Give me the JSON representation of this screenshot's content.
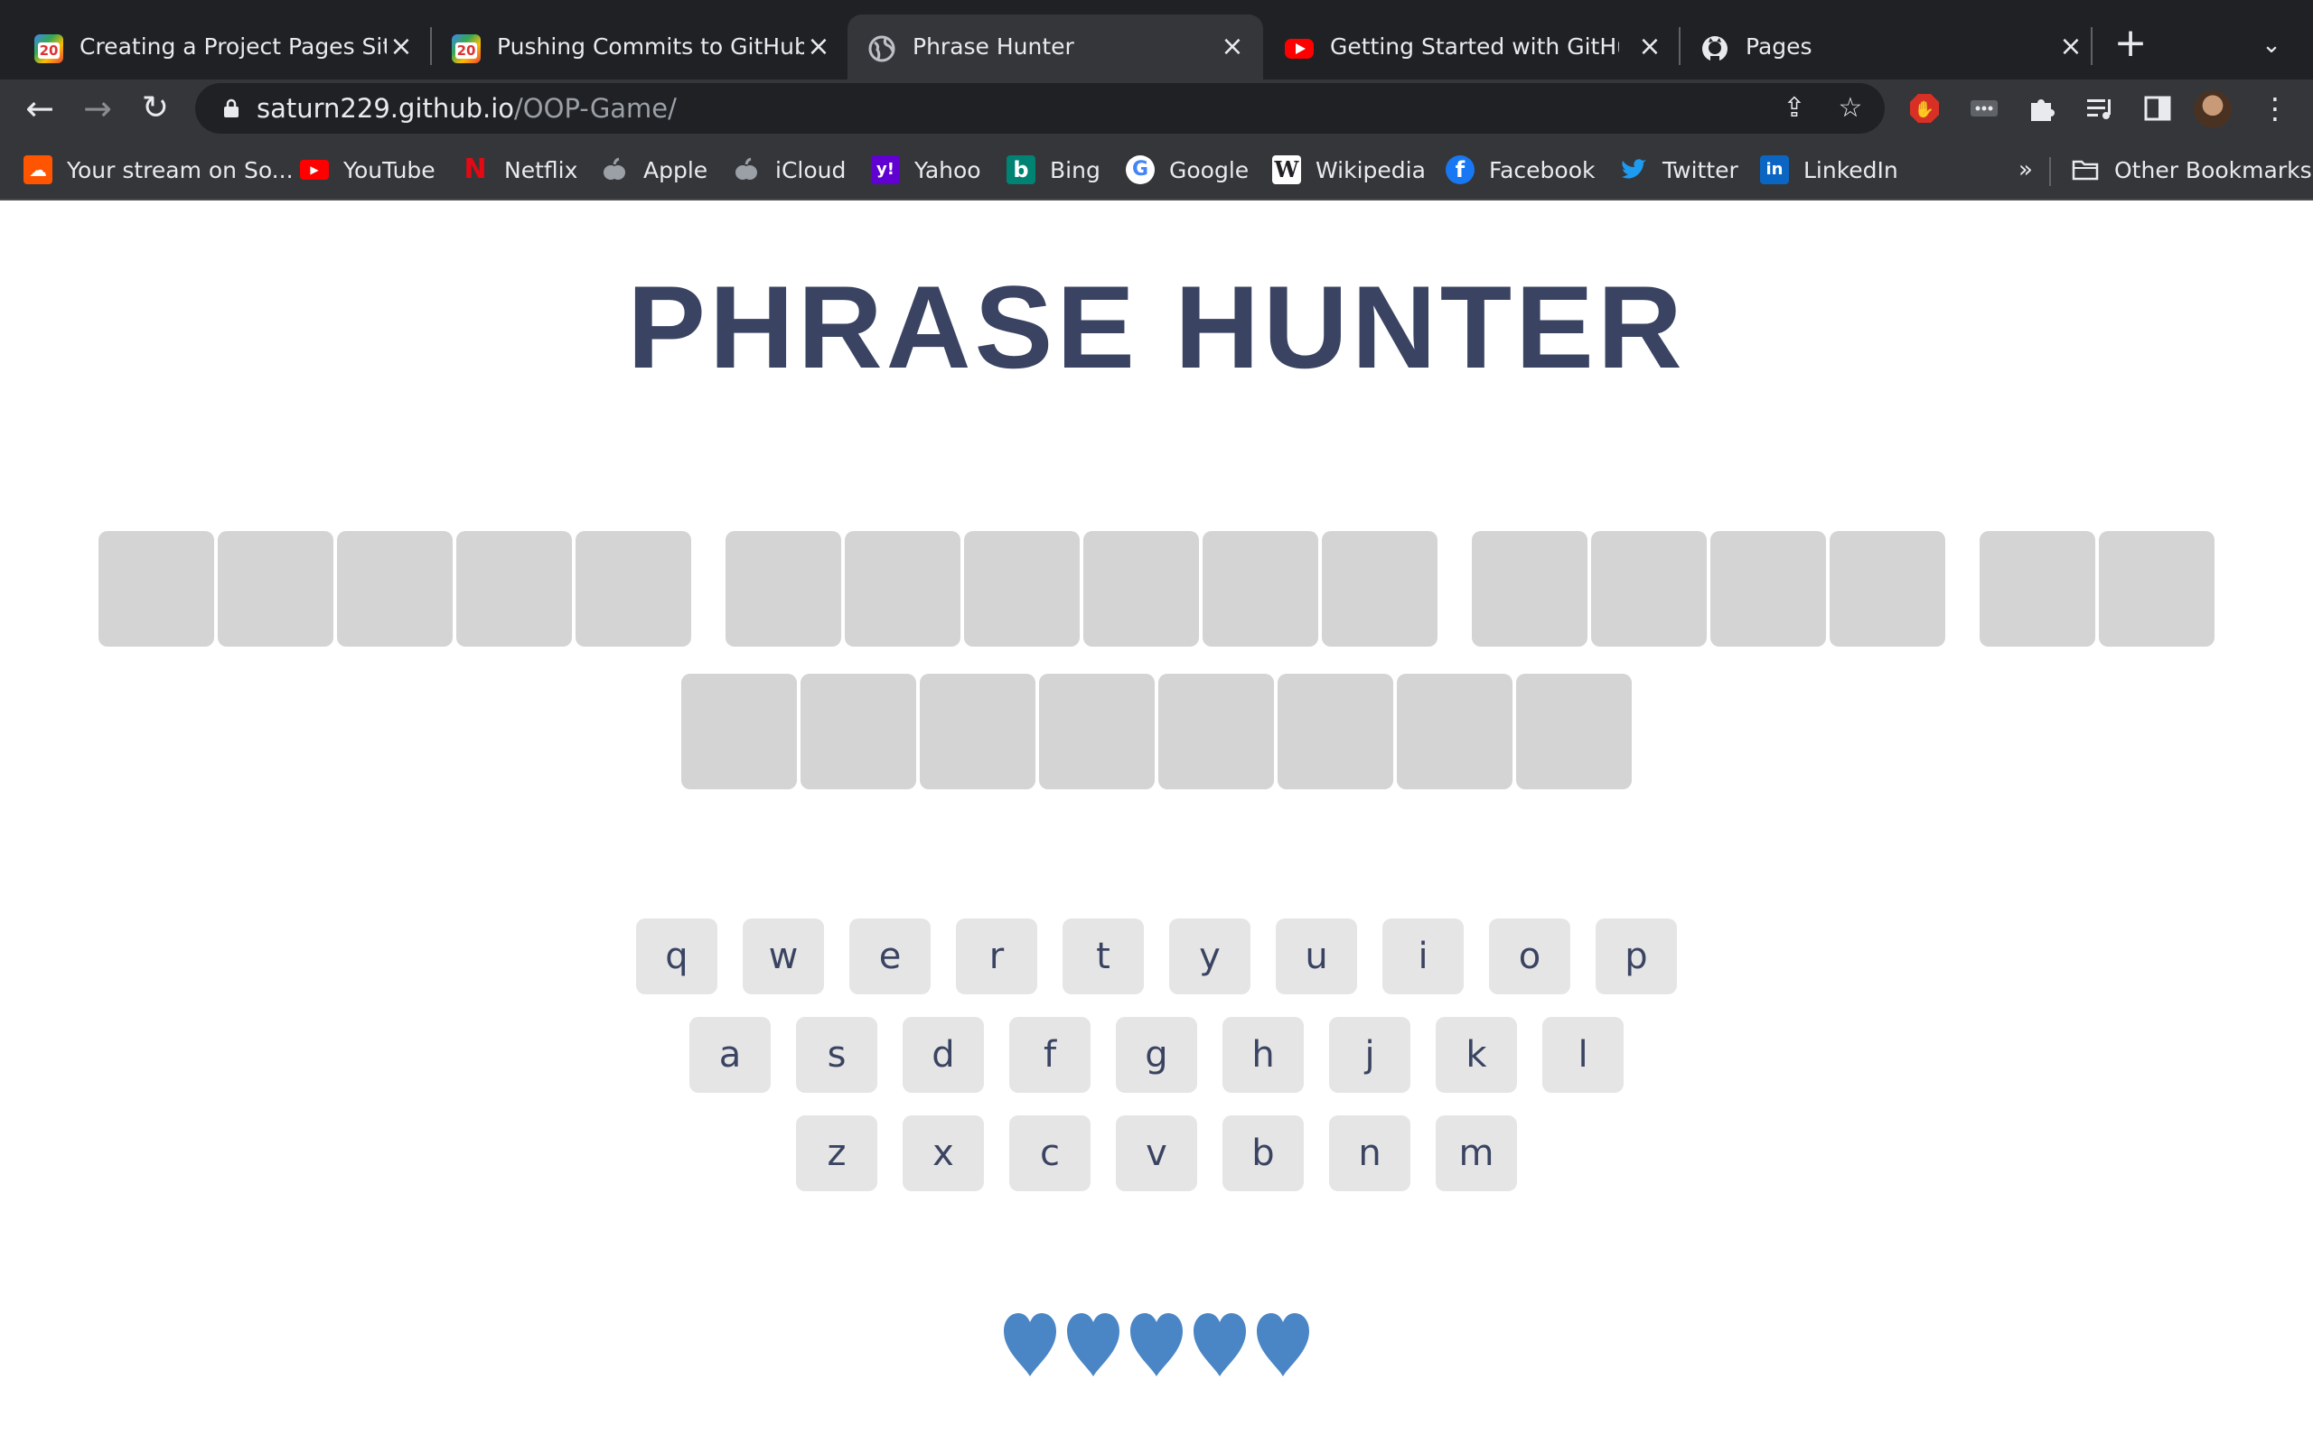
{
  "browser": {
    "tabs": [
      {
        "title": "Creating a Project Pages Site",
        "icon": "treehouse-20-icon"
      },
      {
        "title": "Pushing Commits to GitHub (",
        "icon": "treehouse-20-icon"
      },
      {
        "title": "Phrase Hunter",
        "icon": "globe-icon",
        "active": true
      },
      {
        "title": "Getting Started with GitHub P",
        "icon": "youtube-icon"
      },
      {
        "title": "Pages",
        "icon": "github-icon"
      }
    ],
    "url_host": "saturn229.github.io",
    "url_path": "/OOP-Game/",
    "bookmarks": [
      {
        "label": "Your stream on So...",
        "icon": "soundcloud-icon",
        "color": "#ff5500"
      },
      {
        "label": "YouTube",
        "icon": "youtube-icon",
        "color": "#ff0000"
      },
      {
        "label": "Netflix",
        "icon": "netflix-icon",
        "color": "#e50914"
      },
      {
        "label": "Apple",
        "icon": "apple-icon",
        "color": "#9aa0a6"
      },
      {
        "label": "iCloud",
        "icon": "apple-icon",
        "color": "#9aa0a6"
      },
      {
        "label": "Yahoo",
        "icon": "yahoo-icon",
        "color": "#6001d2"
      },
      {
        "label": "Bing",
        "icon": "bing-icon",
        "color": "#008373"
      },
      {
        "label": "Google",
        "icon": "google-icon",
        "color": "#ffffff"
      },
      {
        "label": "Wikipedia",
        "icon": "wikipedia-icon",
        "color": "#ffffff"
      },
      {
        "label": "Facebook",
        "icon": "facebook-icon",
        "color": "#1877f2"
      },
      {
        "label": "Twitter",
        "icon": "twitter-icon",
        "color": "#1d9bf0"
      },
      {
        "label": "LinkedIn",
        "icon": "linkedin-icon",
        "color": "#0a66c2"
      }
    ],
    "overflow_label": "»",
    "other_bookmarks": "Other Bookmarks"
  },
  "game": {
    "title": "PHRASE HUNTER",
    "phrase_rows": [
      [
        5,
        6,
        4,
        2
      ],
      [
        8
      ]
    ],
    "keyboard_rows": [
      [
        "q",
        "w",
        "e",
        "r",
        "t",
        "y",
        "u",
        "i",
        "o",
        "p"
      ],
      [
        "a",
        "s",
        "d",
        "f",
        "g",
        "h",
        "j",
        "k",
        "l"
      ],
      [
        "z",
        "x",
        "c",
        "v",
        "b",
        "n",
        "m"
      ]
    ],
    "lives": 5,
    "heart_color": "#4a86c5",
    "tile_color": "#d4d4d4",
    "key_color": "#e5e5e5",
    "title_color": "#3a4462"
  }
}
